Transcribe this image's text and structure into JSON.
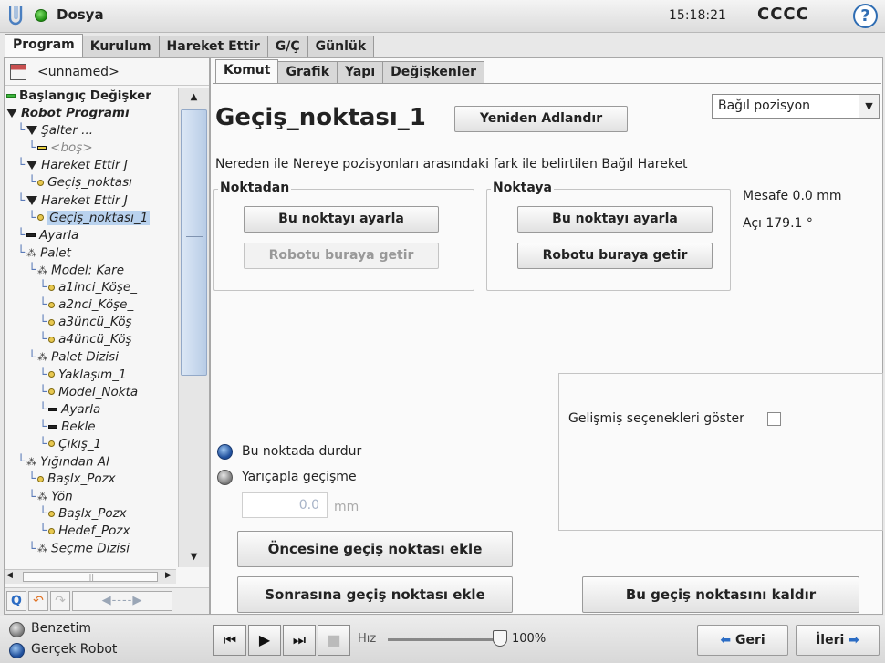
{
  "topbar": {
    "title": "Dosya",
    "clock": "15:18:21",
    "robot_name": "CCCC",
    "help": "?"
  },
  "main_tabs": [
    "Program",
    "Kurulum",
    "Hareket Ettir",
    "G/Ç",
    "Günlük"
  ],
  "left": {
    "file_name": "<unnamed>",
    "tree": [
      {
        "label": "Başlangıç Değişker",
        "depth": 0,
        "marker": "bar-green",
        "style": "root"
      },
      {
        "label": "Robot Programı",
        "depth": 0,
        "marker": "tri",
        "style": "bold"
      },
      {
        "label": "Şalter ...",
        "depth": 1,
        "marker": "tri"
      },
      {
        "label": "<boş>",
        "depth": 2,
        "marker": "bar-yellow"
      },
      {
        "label": "Hareket Ettir J",
        "depth": 1,
        "marker": "tri"
      },
      {
        "label": "Geçiş_noktası",
        "depth": 2,
        "marker": "dot"
      },
      {
        "label": "Hareket Ettir J",
        "depth": 1,
        "marker": "tri"
      },
      {
        "label": "Geçiş_noktası_1",
        "depth": 2,
        "marker": "dot",
        "selected": true
      },
      {
        "label": "Ayarla",
        "depth": 1,
        "marker": "bar"
      },
      {
        "label": "Palet",
        "depth": 1,
        "marker": "pal"
      },
      {
        "label": "Model: Kare",
        "depth": 2,
        "marker": "pal"
      },
      {
        "label": "a1inci_Köşe_",
        "depth": 3,
        "marker": "dot"
      },
      {
        "label": "a2nci_Köşe_",
        "depth": 3,
        "marker": "dot"
      },
      {
        "label": "a3üncü_Köş",
        "depth": 3,
        "marker": "dot"
      },
      {
        "label": "a4üncü_Köş",
        "depth": 3,
        "marker": "dot"
      },
      {
        "label": "Palet Dizisi",
        "depth": 2,
        "marker": "pal"
      },
      {
        "label": "Yaklaşım_1",
        "depth": 3,
        "marker": "dot"
      },
      {
        "label": "Model_Nokta",
        "depth": 3,
        "marker": "dot"
      },
      {
        "label": "Ayarla",
        "depth": 3,
        "marker": "bar"
      },
      {
        "label": "Bekle",
        "depth": 3,
        "marker": "bar"
      },
      {
        "label": "Çıkış_1",
        "depth": 3,
        "marker": "dot"
      },
      {
        "label": "Yığından Al",
        "depth": 1,
        "marker": "pal"
      },
      {
        "label": "Başlx_Pozx",
        "depth": 2,
        "marker": "dot"
      },
      {
        "label": "Yön",
        "depth": 2,
        "marker": "pal"
      },
      {
        "label": "Başlx_Pozx",
        "depth": 3,
        "marker": "dot"
      },
      {
        "label": "Hedef_Pozx",
        "depth": 3,
        "marker": "dot"
      },
      {
        "label": "Seçme Dizisi",
        "depth": 2,
        "marker": "pal"
      }
    ],
    "toolbar": {
      "search": "Q",
      "undo": "↶",
      "redo": "↷",
      "move": "◀----▶"
    }
  },
  "sub_tabs": [
    "Komut",
    "Grafik",
    "Yapı",
    "Değişkenler"
  ],
  "waypoint": {
    "title": "Geçiş_noktası_1",
    "rename_label": "Yeniden Adlandır",
    "mode_select": "Bağıl pozisyon",
    "description": "Nereden ile Nereye pozisyonları arasındaki fark ile belirtilen Bağıl Hareket",
    "from": {
      "label": "Noktadan",
      "set_label": "Bu noktayı ayarla",
      "move_label": "Robotu buraya getir"
    },
    "to": {
      "label": "Noktaya",
      "set_label": "Bu noktayı ayarla",
      "move_label": "Robotu buraya getir"
    },
    "distance": "Mesafe 0.0 mm",
    "angle": "Açı 179.1 °",
    "advanced_label": "Gelişmiş seçenekleri göster",
    "stop_label": "Bu noktada durdur",
    "blend_label": "Yarıçapla geçişme",
    "blend_value": "0.0",
    "blend_unit": "mm",
    "add_before": "Öncesine geçiş noktası ekle",
    "add_after": "Sonrasına geçiş noktası ekle",
    "remove": "Bu geçiş noktasını kaldır"
  },
  "bottombar": {
    "simulation": "Benzetim",
    "real_robot": "Gerçek Robot",
    "speed_label": "Hız",
    "speed_value": "100%",
    "speed_fraction": 1.0,
    "back_label": "Geri",
    "next_label": "İleri"
  },
  "colors": {
    "accent": "#2b6cc4",
    "status_ok": "#2fa31f",
    "selection": "#b9d2ee"
  }
}
